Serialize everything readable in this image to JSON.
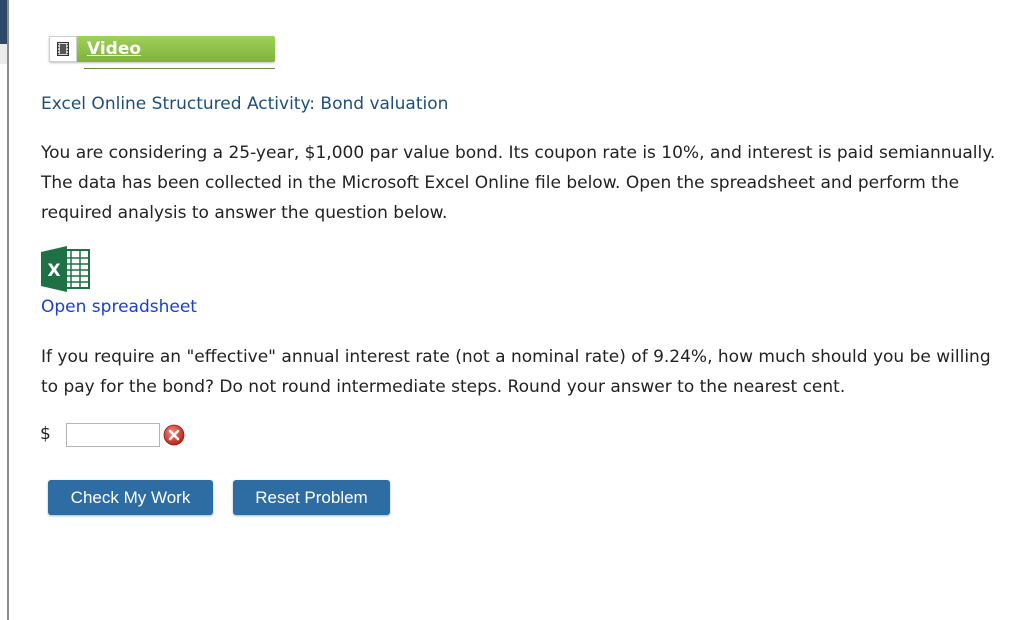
{
  "video": {
    "label": "Video"
  },
  "activity_title": "Excel Online Structured Activity: Bond valuation",
  "intro_text": "You are considering a 25-year, $1,000 par value bond. Its coupon rate is 10%, and interest is paid semiannually. The data has been collected in the Microsoft Excel Online file below. Open the spreadsheet and perform the required analysis to answer the question below.",
  "spreadsheet": {
    "icon": "excel-icon",
    "link_label": "Open spreadsheet"
  },
  "question_text": "If you require an \"effective\" annual interest rate (not a nominal rate) of 9.24%, how much should you be willing to pay for the bond? Do not round intermediate steps. Round your answer to the nearest cent.",
  "answer": {
    "currency": "$",
    "value": "",
    "status_icon": "error-x-icon"
  },
  "buttons": {
    "check": "Check My Work",
    "reset": "Reset Problem"
  },
  "colors": {
    "button_blue": "#2e6da4",
    "video_green": "#8cc24a",
    "title_blue": "#1f4e79",
    "link_blue": "#1a3fd0",
    "error_red": "#c0392b"
  }
}
